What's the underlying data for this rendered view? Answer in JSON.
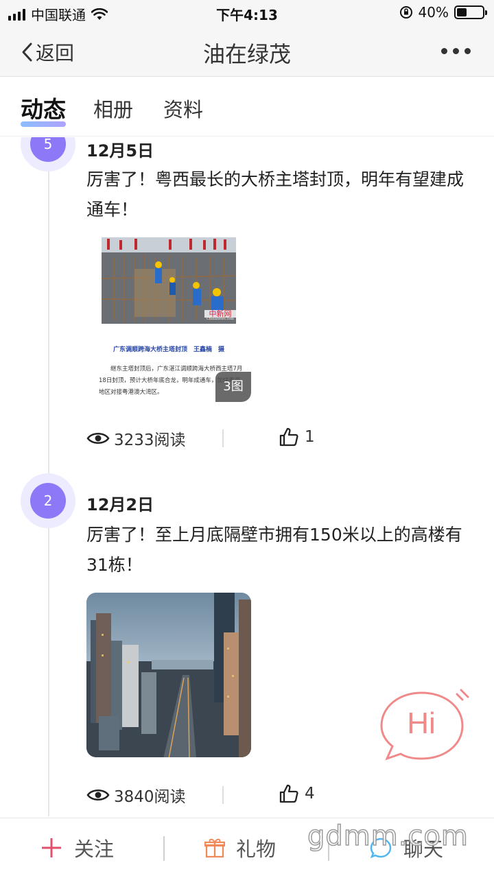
{
  "status_bar": {
    "carrier": "中国联通",
    "time": "下午4:13",
    "battery_text": "40%",
    "battery_level": 0.4
  },
  "nav": {
    "back_label": "返回",
    "title": "油在绿茂"
  },
  "tabs": [
    {
      "label": "动态",
      "active": true
    },
    {
      "label": "相册",
      "active": false
    },
    {
      "label": "资料",
      "active": false
    }
  ],
  "posts": [
    {
      "badge": "5",
      "date": "12月5日",
      "text": "厉害了！粤西最长的大桥主塔封顶，明年有望建成通车！",
      "image": {
        "caption": "广东调顺跨海大桥主塔封顶　王鑫楠　摄",
        "body": "继东主塔封顶后，广东湛江调顺跨海大桥西主塔7月18日封顶，预计大桥年底合龙，明年成通车，加快粤西地区对接粤港澳大湾区。",
        "source": "中新网",
        "source_sub": "Chinanews.com",
        "count_label": "3图"
      },
      "reads": "3233阅读",
      "likes": "1"
    },
    {
      "badge": "2",
      "date": "12月2日",
      "text": "厉害了！至上月底隔壁市拥有150米以上的高楼有31栋！",
      "reads": "3840阅读",
      "likes": "4"
    }
  ],
  "hi_bubble": {
    "label": "Hi"
  },
  "bottom_bar": {
    "follow_label": "关注",
    "gift_label": "礼物",
    "chat_label": "聊天"
  },
  "watermark": "gdmm.com",
  "colors": {
    "badge": "#8d78f7",
    "hi": "#f08a8a",
    "follow_icon": "#e0506a",
    "gift_icon": "#f08a5a",
    "chat_icon": "#4fb6f0"
  }
}
